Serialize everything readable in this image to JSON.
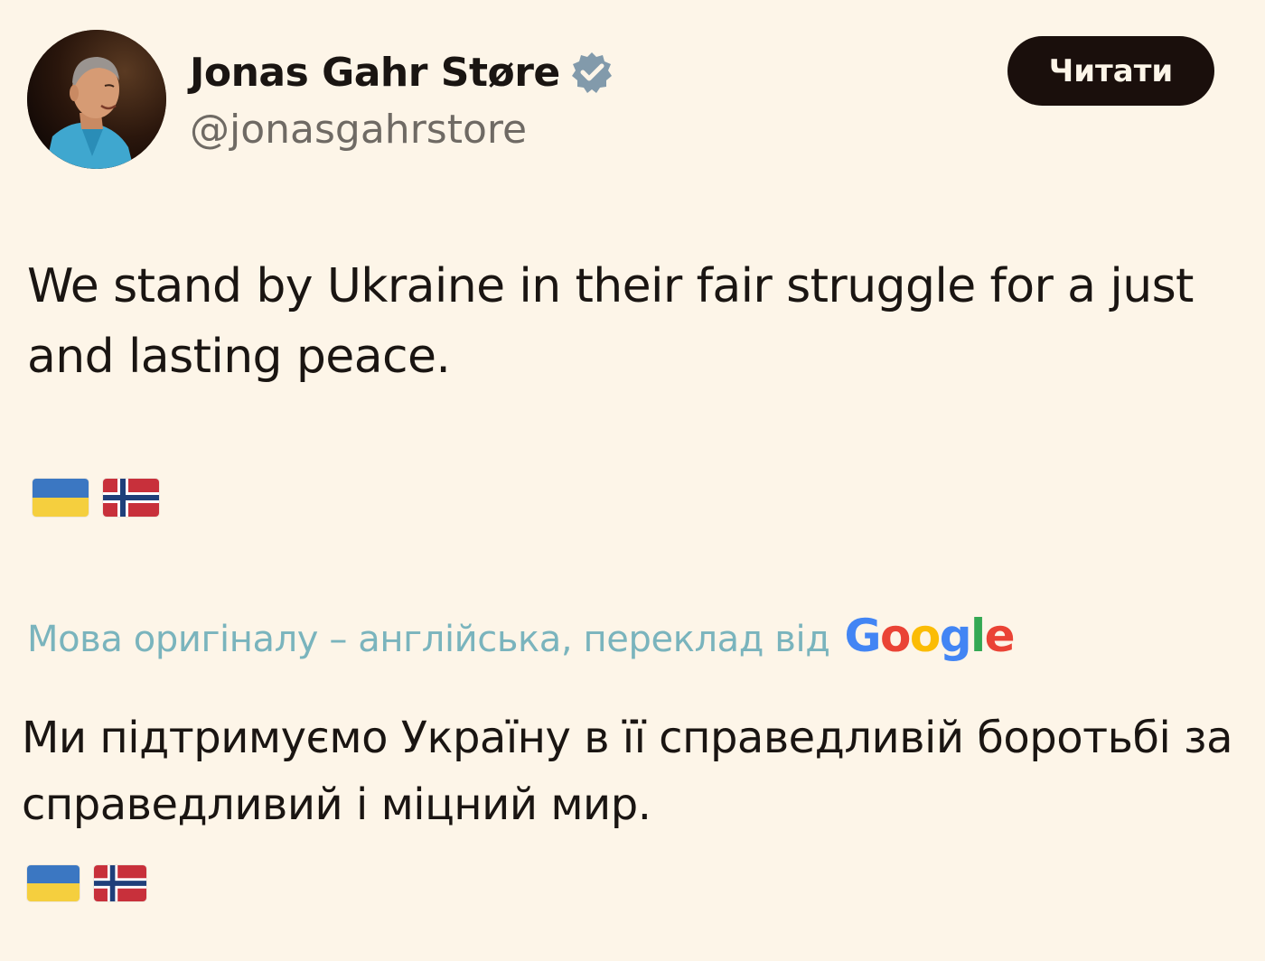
{
  "author": {
    "display_name": "Jonas Gahr Støre",
    "handle": "@jonasgahrstore",
    "verified": true
  },
  "follow_button": {
    "label": "Читати"
  },
  "tweet": {
    "text": "We stand by Ukraine in their fair struggle for a just and lasting peace.",
    "flags": [
      "flag-ukraine",
      "flag-norway"
    ]
  },
  "translation": {
    "label": "Мова оригіналу – англійська, переклад від",
    "provider": "Google",
    "text": "Ми підтримуємо Україну в її справедливій боротьбі за справедливий і міцний мир.",
    "flags": [
      "flag-ukraine",
      "flag-norway"
    ]
  },
  "colors": {
    "background": "#fdf5e8",
    "button": "#1a0f0c",
    "translation_label": "#7ab4bd",
    "verified_badge": "#829aab",
    "ukraine_blue": "#3b77c2",
    "ukraine_yellow": "#f5cf3e",
    "norway_red": "#c8303b",
    "norway_blue": "#1f3f7a"
  }
}
